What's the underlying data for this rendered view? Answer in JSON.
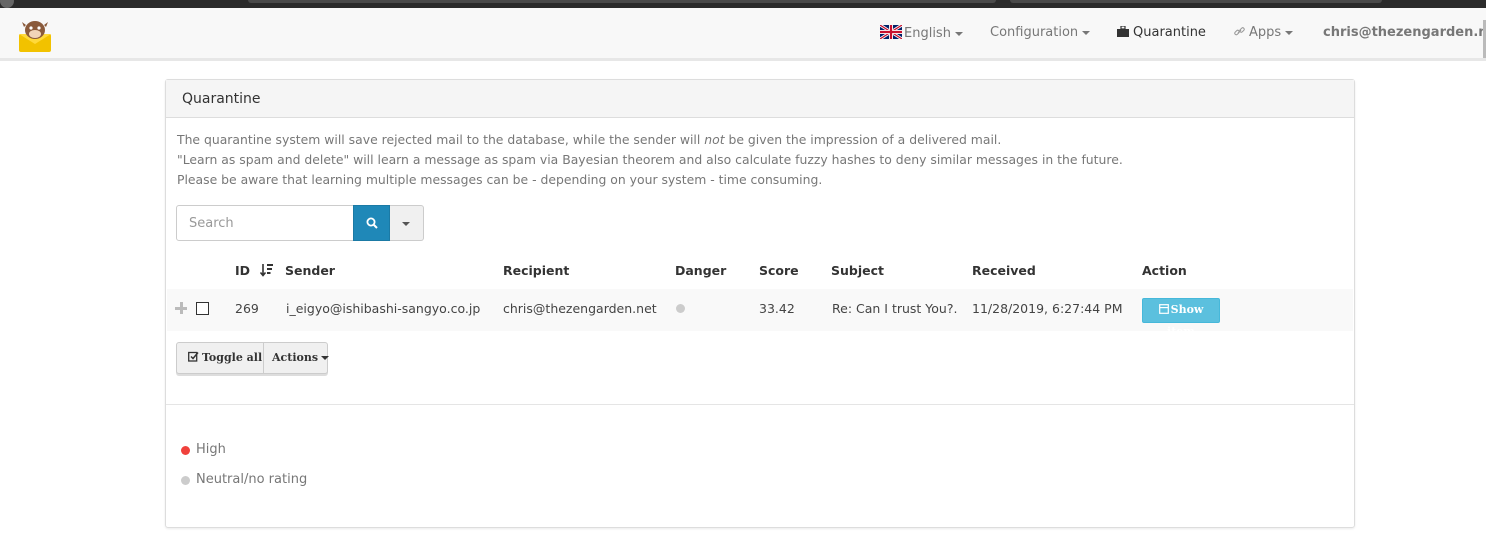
{
  "navbar": {
    "language": "English",
    "configuration": "Configuration",
    "quarantine": "Quarantine",
    "apps": "Apps",
    "user": "chris@thezengarden.net"
  },
  "panel": {
    "title": "Quarantine",
    "desc_line1_a": "The quarantine system will save rejected mail to the database, while the sender will ",
    "desc_line1_em": "not",
    "desc_line1_b": " be given the impression of a delivered mail.",
    "desc_line2": "\"Learn as spam and delete\" will learn a message as spam via Bayesian theorem and also calculate fuzzy hashes to deny similar messages in the future.",
    "desc_line3": "Please be aware that learning multiple messages can be - depending on your system - time consuming."
  },
  "search": {
    "placeholder": "Search"
  },
  "table": {
    "headers": {
      "id": "ID",
      "sender": "Sender",
      "recipient": "Recipient",
      "danger": "Danger",
      "score": "Score",
      "subject": "Subject",
      "received": "Received",
      "action": "Action"
    },
    "rows": [
      {
        "id": "269",
        "sender": "i_eigyo@ishibashi-sangyo.co.jp",
        "recipient": "chris@thezengarden.net",
        "score": "33.42",
        "subject": "Re: Can I trust You?.",
        "received": "11/28/2019, 6:27:44 PM",
        "action": "Show item"
      }
    ]
  },
  "buttons": {
    "toggle_all": "Toggle all",
    "actions": "Actions"
  },
  "legend": [
    {
      "label": "High",
      "color": "#f0413c"
    },
    {
      "label": "Neutral/no rating",
      "color": "#cccccc"
    }
  ],
  "colors": {
    "primary": "#1f88b8",
    "info": "#5bc0de",
    "danger_high": "#f0413c",
    "neutral": "#cccccc"
  }
}
